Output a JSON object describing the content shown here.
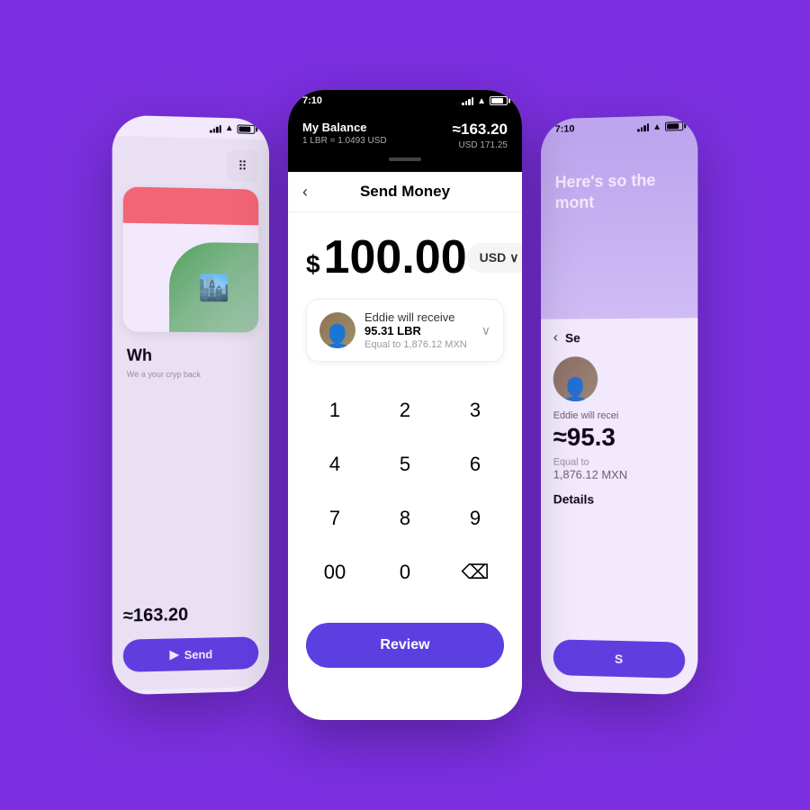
{
  "background": "#7B2FE0",
  "left_phone": {
    "status_bar": {
      "signal": "signal",
      "wifi": "wifi",
      "battery": "battery"
    },
    "qr_button_label": "QR",
    "balance": "≈163.20",
    "send_button": "Send",
    "what_title": "Wh",
    "what_subtitle": "We a your cryp back",
    "card_illustration": "🏙️"
  },
  "center_phone": {
    "status_bar": {
      "time": "7:10",
      "signal": "signal",
      "wifi": "wifi",
      "battery": "battery"
    },
    "header": {
      "balance_label": "My Balance",
      "balance_amount": "≈163.20",
      "exchange_rate": "1 LBR = 1.0493 USD",
      "usd_amount": "USD 171.25"
    },
    "nav": {
      "back_button": "‹",
      "title": "Send Money"
    },
    "amount_section": {
      "currency_symbol": "$",
      "amount": "100.00",
      "currency_selector": "USD",
      "currency_chevron": "∨"
    },
    "recipient": {
      "name": "Eddie",
      "receive_amount": "95.31 LBR",
      "receive_label": "Eddie will receive",
      "equal_label": "Equal to 1,876.12 MXN"
    },
    "numpad": {
      "keys": [
        "1",
        "2",
        "3",
        "4",
        "5",
        "6",
        "7",
        "8",
        "9",
        "00",
        "0",
        "⌫"
      ],
      "row1": [
        "1",
        "2",
        "3"
      ],
      "row2": [
        "4",
        "5",
        "6"
      ],
      "row3": [
        "7",
        "8",
        "9"
      ],
      "row4": [
        "00",
        "0",
        "⌫"
      ]
    },
    "review_button": "Review"
  },
  "right_phone": {
    "status_bar": {
      "time": "7:10",
      "signal": "signal",
      "wifi": "wifi",
      "battery": "battery"
    },
    "hero_text": "Here's so the mont",
    "nav": {
      "back_button": "‹",
      "title": "Se"
    },
    "recipient": {
      "label": "Eddie will recei",
      "amount": "≈95.3",
      "equal_label": "Equal to",
      "mxn": "1,876.12 MXN"
    },
    "details_title": "Details",
    "confirm_button": "S"
  }
}
